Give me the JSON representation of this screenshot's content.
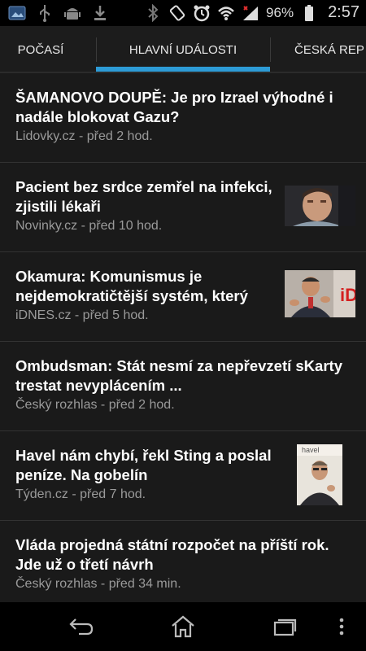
{
  "status_bar": {
    "left_icons": [
      "image-icon",
      "usb-icon",
      "android-icon",
      "download-icon"
    ],
    "right_icons": [
      "bluetooth-icon",
      "rotation-icon",
      "alarm-icon",
      "wifi-icon",
      "signal-icon"
    ],
    "battery": "96%",
    "time": "2:57"
  },
  "tabs": [
    {
      "label": "POČASÍ"
    },
    {
      "label": "HLAVNÍ UDÁLOSTI",
      "selected": true
    },
    {
      "label": "ČESKÁ REP"
    }
  ],
  "accent_color": "#2d9bd6",
  "news": [
    {
      "headline_line1": "ŠAMANOVO DOUPĚ: Je pro Izrael výhodné i",
      "headline_line2": "nadále blokovat Gazu?",
      "source": "Lidovky.cz - před 2 hod."
    },
    {
      "headline_line1": "Pacient bez srdce zemřel na infekci,",
      "headline_line2": "zjistili lékaři",
      "source": "Novinky.cz - před 10 hod.",
      "thumbnail": "man-portrait-photo"
    },
    {
      "headline_line1": "Okamura: Komunismus je",
      "headline_line2": "nejdemokratičtější systém, který",
      "source": "iDNES.cz - před 5 hod.",
      "thumbnail": "politician-at-press-photo"
    },
    {
      "headline_line1": "Ombudsman: Stát nesmí za nepřevzetí sKarty",
      "headline_line2": "trestat nevyplácením ...",
      "source": "Český rozhlas - před 2 hod."
    },
    {
      "headline_line1": "Havel nám chybí, řekl Sting a poslal",
      "headline_line2": "peníze. Na gobelín",
      "source": "Týden.cz - před 7 hod.",
      "thumbnail": "sting-photo"
    },
    {
      "headline_line1": "Vláda projedná státní rozpočet na příští rok.",
      "headline_line2": "Jde už o třetí návrh",
      "source": "Český rozhlas - před 34 min."
    }
  ],
  "nav_bar": {
    "buttons": [
      "back-icon",
      "home-icon",
      "recent-apps-icon",
      "menu-icon"
    ]
  }
}
